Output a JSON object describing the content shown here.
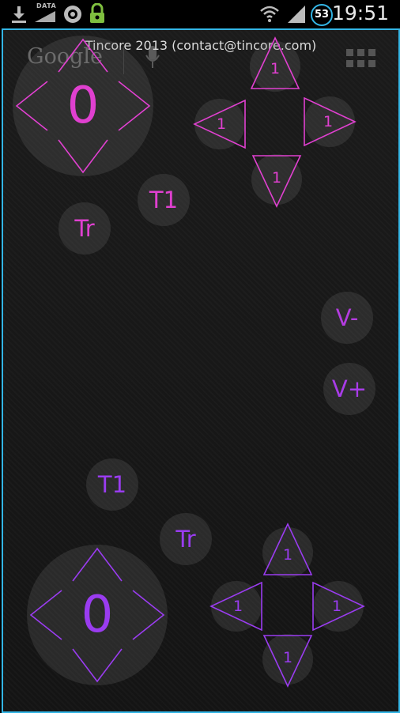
{
  "statusbar": {
    "data_label": "DATA",
    "notification_count": "53",
    "time": "19:51"
  },
  "launcher": {
    "search_text": "Google"
  },
  "app": {
    "header": "Tincore 2013 (contact@tincore.com)"
  },
  "colors": {
    "pink": "#e040d0",
    "purple": "#9a3cf0",
    "accent": "#33b5e5"
  },
  "player1": {
    "joystick_value": "0",
    "dpad": {
      "up": "1",
      "left": "1",
      "right": "1",
      "down": "1"
    },
    "buttons": {
      "t1": "T1",
      "tr": "Tr"
    }
  },
  "player2": {
    "joystick_value": "0",
    "dpad": {
      "up": "1",
      "left": "1",
      "right": "1",
      "down": "1"
    },
    "buttons": {
      "t1": "T1",
      "tr": "Tr"
    }
  },
  "volume": {
    "down": "V-",
    "up": "V+"
  }
}
